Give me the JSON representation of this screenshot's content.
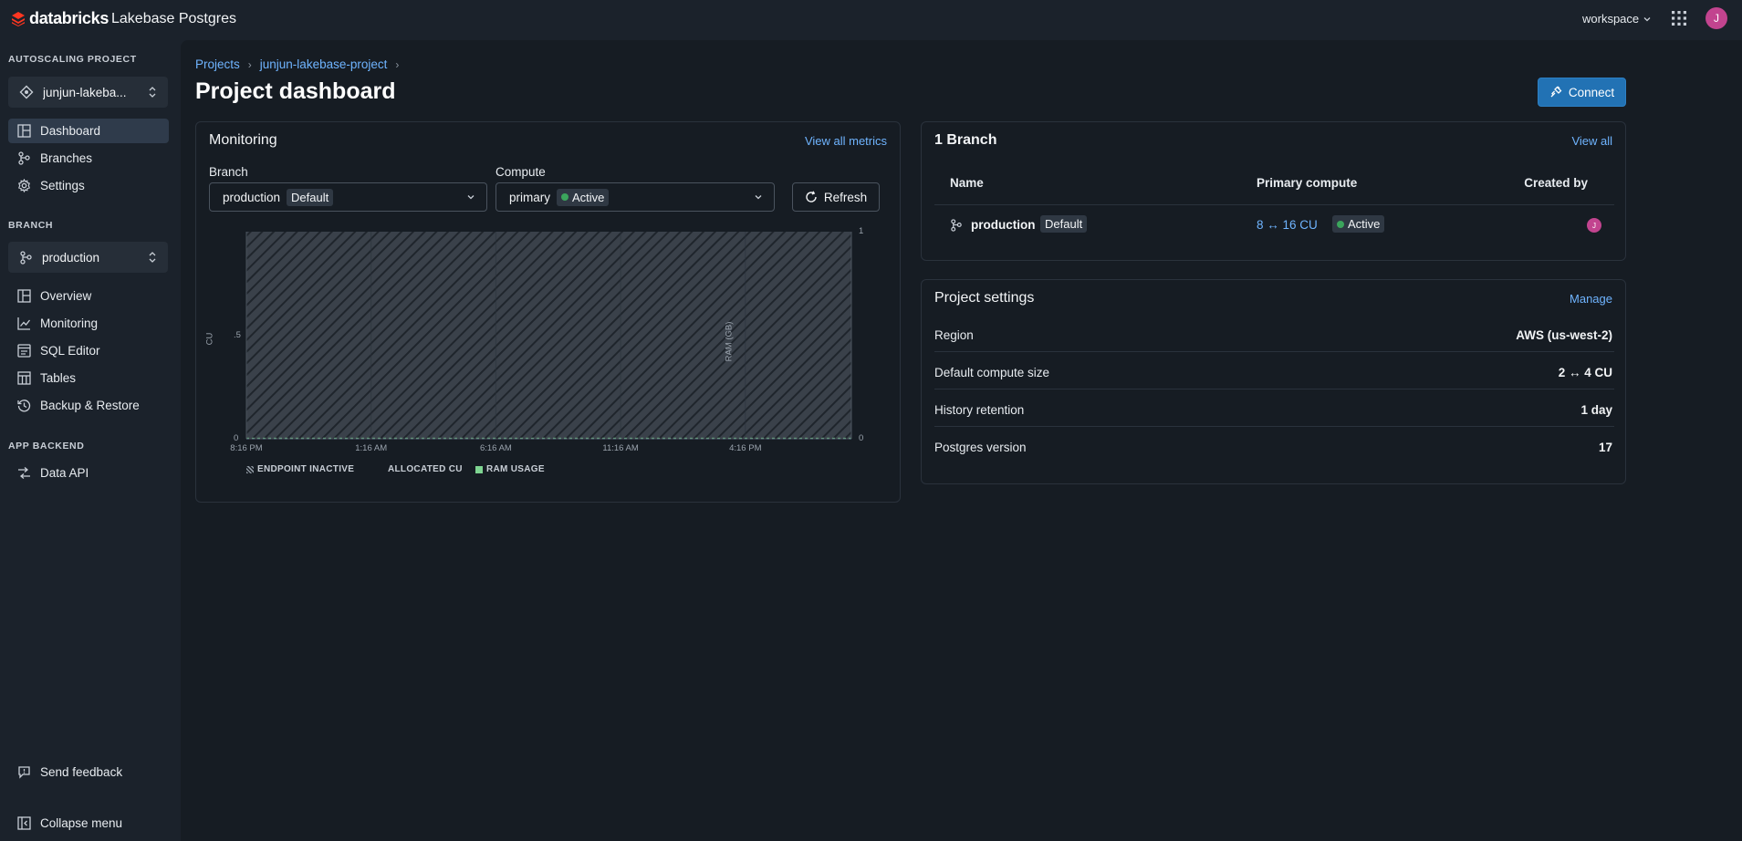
{
  "header": {
    "brand": "databricks",
    "app_title": "Lakebase Postgres",
    "workspace_label": "workspace",
    "user_initial": "J"
  },
  "sidebar": {
    "project_section": "AUTOSCALING PROJECT",
    "project_name": "junjun-lakeba...",
    "project_items": [
      {
        "label": "Dashboard",
        "icon": "dashboard-icon",
        "active": true
      },
      {
        "label": "Branches",
        "icon": "branch-icon"
      },
      {
        "label": "Settings",
        "icon": "gear-icon"
      }
    ],
    "branch_section": "BRANCH",
    "branch_name": "production",
    "branch_items": [
      {
        "label": "Overview",
        "icon": "dashboard-icon"
      },
      {
        "label": "Monitoring",
        "icon": "chart-line-icon"
      },
      {
        "label": "SQL Editor",
        "icon": "sql-editor-icon"
      },
      {
        "label": "Tables",
        "icon": "table-icon"
      },
      {
        "label": "Backup & Restore",
        "icon": "history-icon"
      }
    ],
    "app_section": "APP BACKEND",
    "app_items": [
      {
        "label": "Data API",
        "icon": "data-api-icon"
      }
    ],
    "send_feedback": "Send feedback",
    "collapse_menu": "Collapse menu"
  },
  "breadcrumb": [
    "Projects",
    "junjun-lakebase-project"
  ],
  "page_title": "Project dashboard",
  "connect_label": "Connect",
  "monitoring": {
    "title": "Monitoring",
    "view_all": "View all metrics",
    "branch_label": "Branch",
    "branch_value": "production",
    "branch_tag": "Default",
    "compute_label": "Compute",
    "compute_value": "primary",
    "compute_status": "Active",
    "refresh_label": "Refresh"
  },
  "chart_data": {
    "type": "area",
    "x_ticks": [
      "8:16 PM",
      "1:16 AM",
      "6:16 AM",
      "11:16 AM",
      "4:16 PM"
    ],
    "y_left_label": "CU",
    "y_left_ticks": [
      "0",
      ".5",
      "1"
    ],
    "y_left_lim": [
      0,
      1
    ],
    "y_right_label": "RAM (GB)",
    "y_right_ticks": [
      "0",
      "1"
    ],
    "y_right_lim": [
      0,
      1
    ],
    "series": [
      {
        "name": "ENDPOINT INACTIVE",
        "values": [
          1,
          1,
          1,
          1,
          1
        ],
        "color": "#8b949e",
        "pattern": "hatch"
      },
      {
        "name": "ALLOCATED CU",
        "values": [
          0,
          0,
          0,
          0,
          0
        ],
        "color": "#6fb4ff"
      },
      {
        "name": "RAM USAGE",
        "values": [
          0,
          0,
          0,
          0,
          0
        ],
        "color": "#7ed491"
      }
    ]
  },
  "branches": {
    "title": "1 Branch",
    "view_all": "View all",
    "columns": [
      "Name",
      "Primary compute",
      "Created by"
    ],
    "rows": [
      {
        "name": "production",
        "tag": "Default",
        "compute": "8 ↔ 16 CU",
        "status": "Active",
        "created_by_initial": "J"
      }
    ]
  },
  "project_settings": {
    "title": "Project settings",
    "manage": "Manage",
    "rows": [
      {
        "label": "Region",
        "value": "AWS (us-west-2)"
      },
      {
        "label": "Default compute size",
        "value": "2 ↔ 4 CU"
      },
      {
        "label": "History retention",
        "value": "1 day"
      },
      {
        "label": "Postgres version",
        "value": "17"
      }
    ]
  }
}
